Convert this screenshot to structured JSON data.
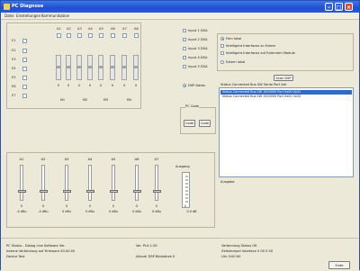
{
  "window": {
    "title": "PC Diagnose"
  },
  "menu": [
    "Datei",
    "Einstellungen",
    "Kommunikation"
  ],
  "channels": [
    "A1",
    "A2",
    "A3",
    "A4",
    "A5",
    "A6",
    "A7",
    "A8"
  ],
  "rows": [
    "E1",
    "E2",
    "E3",
    "E4",
    "E5",
    "E6",
    "E7"
  ],
  "mini_values": [
    "0",
    "0",
    "0",
    "0",
    "0",
    "0",
    "0",
    "0"
  ],
  "groups": [
    "M1",
    "M2",
    "M3",
    "M4"
  ],
  "inputs": [
    "Input 1 DSA",
    "Input 2 DSA",
    "Input 3 DSA",
    "Input 4 DSA",
    "Input 5 DSA"
  ],
  "dsp_label": "DSP Daten",
  "mode_options": [
    {
      "label": "Fern lokal",
      "selected": true
    },
    {
      "label": "Intelligent Interfaces zu Extern"
    },
    {
      "label": "Intelligent Interfaces auf Externem Module"
    },
    {
      "label": "Extern lokal"
    }
  ],
  "scan_button": "Scan DSP",
  "list_header": "Status  Connected Bus  SW  Serial  Port  Adr",
  "list_rows": [
    {
      "text": "Status Connected Bus   SW  1000000  Port  0x00 0x01",
      "selected": true
    },
    {
      "text": "Status Connected Bus   SW  1000000  Port  0x00 0x03",
      "selected": false
    }
  ],
  "list_footer": "Ausgabe",
  "pc_code": {
    "label": "PC Code",
    "buttons": [
      "Code",
      "Code"
    ]
  },
  "faders": [
    {
      "name": "A1",
      "value": "0",
      "db": "-0 dBu"
    },
    {
      "name": "A2",
      "value": "0",
      "db": "-0 dBu"
    },
    {
      "name": "A3",
      "value": "0",
      "db": "0 dBu"
    },
    {
      "name": "A4",
      "value": "0",
      "db": "0 dBu"
    },
    {
      "name": "A5",
      "value": "0",
      "db": "0 dBu"
    },
    {
      "name": "A6",
      "value": "0",
      "db": "0 dBu"
    },
    {
      "name": "A7",
      "value": "0",
      "db": "0 dBu"
    }
  ],
  "output_label": "Ausgang",
  "output_value": "0",
  "output_db": "0.0 dB",
  "status": {
    "left": [
      "PC Status - Dialog Live Software Ver.",
      "Interne Verbindung auf Firmware  00.00.00",
      "Device Test"
    ],
    "middle": [
      "Ver. PLA  1.00",
      "Aktuell DSP Bibliothek  0"
    ],
    "right": [
      "Verbindung Status  OK",
      "Zeitstempel Interface  0  00  0  00",
      "Uhr  0:00:00"
    ],
    "exit_button": "Ende"
  },
  "accent": "#316ac5"
}
